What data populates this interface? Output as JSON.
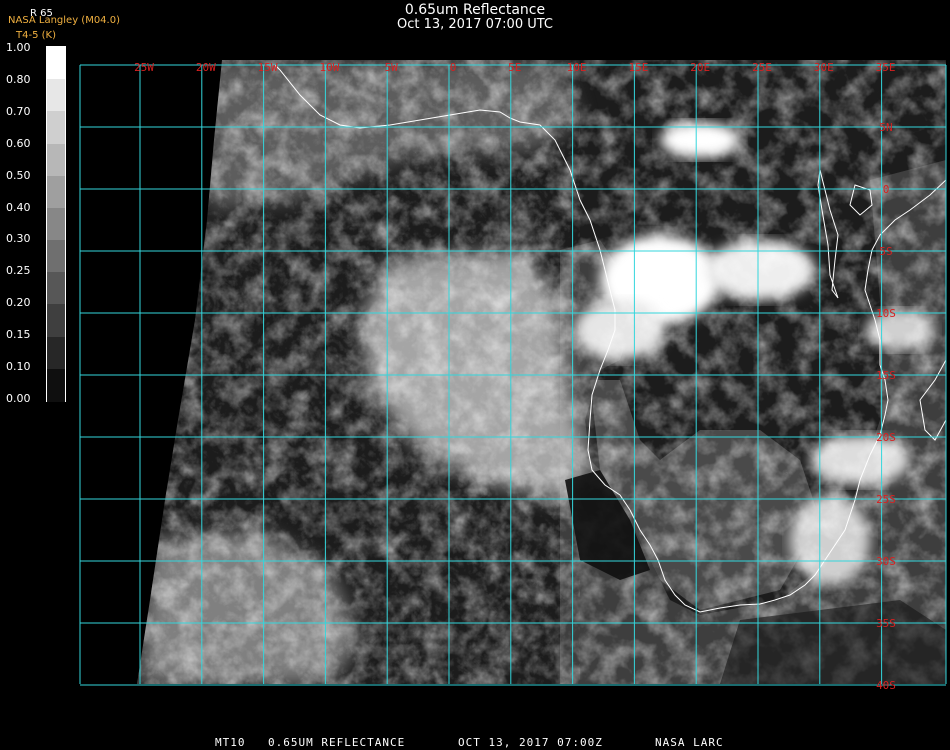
{
  "header": {
    "title": "0.65um Reflectance",
    "datetime": "Oct 13, 2017 07:00 UTC",
    "credit_line1": "NASA Langley (M04.0)",
    "credit_line2": "T4-5 (K)",
    "product_code": "R 65"
  },
  "legend": {
    "labels": [
      "1.00",
      "0.80",
      "0.70",
      "0.60",
      "0.50",
      "0.40",
      "0.30",
      "0.25",
      "0.20",
      "0.15",
      "0.10",
      "0.00"
    ]
  },
  "map": {
    "lon_labels": [
      "25W",
      "20W",
      "15W",
      "10W",
      "5W",
      "0",
      "5E",
      "10E",
      "15E",
      "20E",
      "25E",
      "30E",
      "35E"
    ],
    "lat_labels": [
      "5N",
      "0",
      "5S",
      "10S",
      "15S",
      "20S",
      "25S",
      "30S",
      "35S",
      "40S"
    ],
    "grid_color": "#33d6dc",
    "label_color": "#d82020",
    "coast_color": "#ffffff"
  },
  "footer": {
    "satellite": "MT10",
    "product": "0.65UM REFLECTANCE",
    "datetime": "OCT 13, 2017 07:00Z",
    "source": "NASA LARC"
  }
}
